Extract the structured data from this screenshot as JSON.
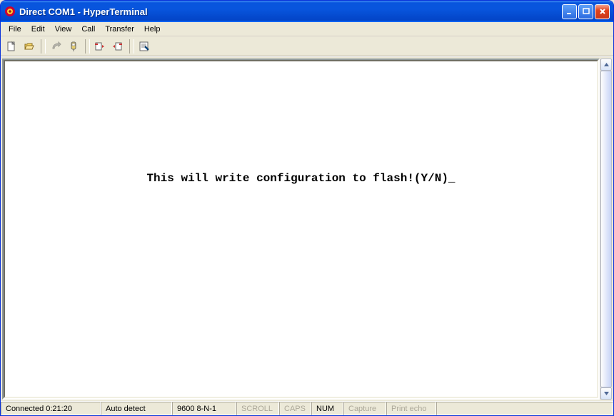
{
  "titlebar": {
    "title": "Direct COM1 - HyperTerminal"
  },
  "menubar": {
    "items": [
      "File",
      "Edit",
      "View",
      "Call",
      "Transfer",
      "Help"
    ]
  },
  "toolbar": {
    "icons": [
      "new",
      "open",
      "connect",
      "disconnect",
      "send",
      "receive",
      "properties"
    ]
  },
  "terminal": {
    "text": "This will write configuration to flash!(Y/N)_"
  },
  "statusbar": {
    "connection": "Connected 0:21:20",
    "autodetect": "Auto detect",
    "port_settings": "9600 8-N-1",
    "scroll": "SCROLL",
    "caps": "CAPS",
    "num": "NUM",
    "capture": "Capture",
    "printecho": "Print echo"
  }
}
